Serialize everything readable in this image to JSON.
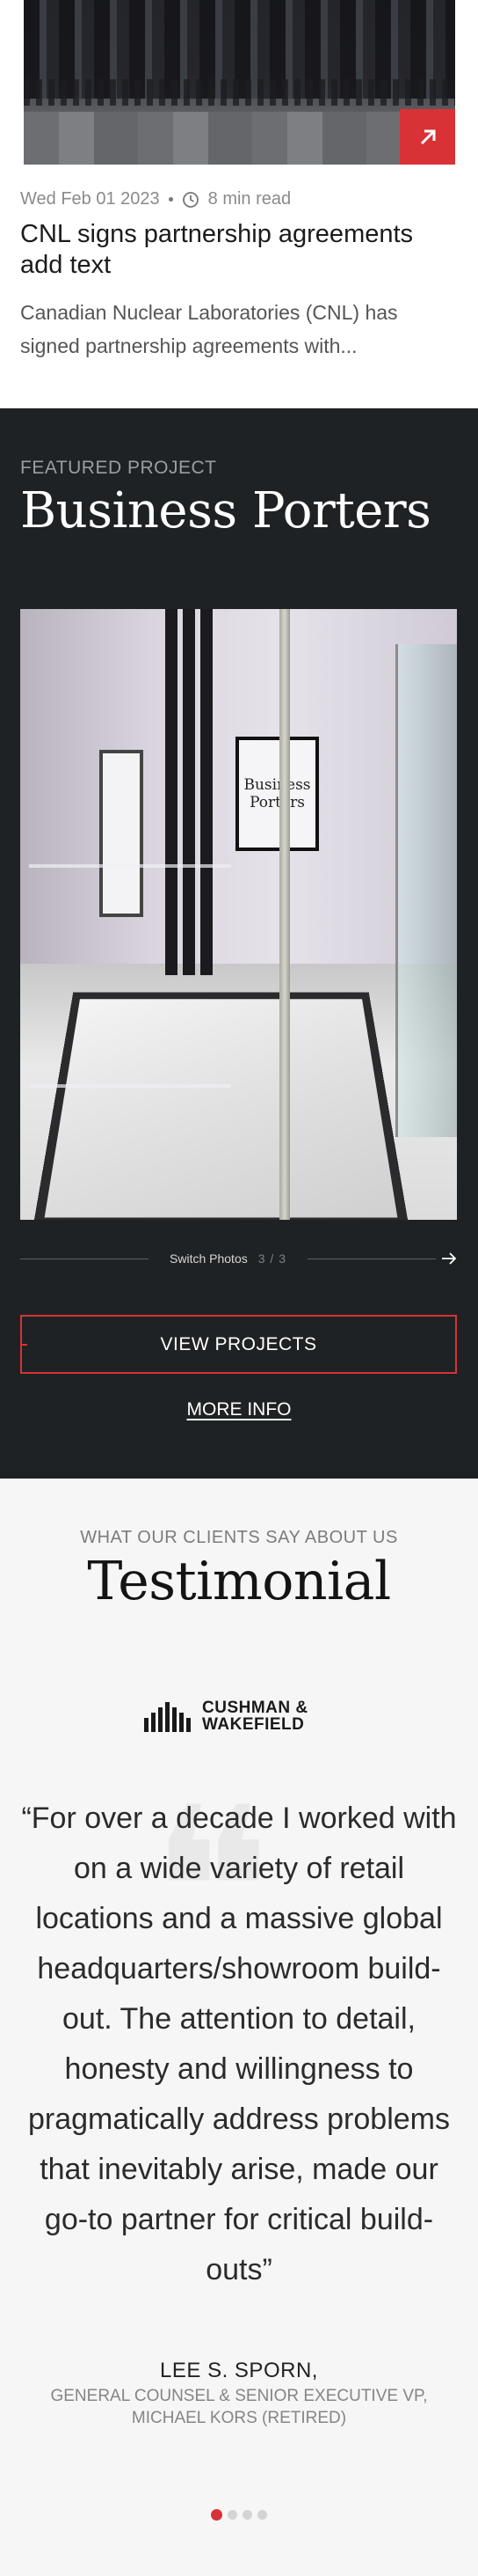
{
  "news": {
    "date": "Wed Feb 01 2023",
    "read_time": "8 min read",
    "title": "CNL signs partnership agreements add text",
    "excerpt": "Canadian Nuclear Laboratories (CNL) has signed partnership agreements with..."
  },
  "featured": {
    "label": "FEATURED PROJECT",
    "title": "Business Porters",
    "photo_sign_text": [
      "Business",
      "Porters"
    ],
    "switch_label": "Switch Photos",
    "switch_count": "3 / 3",
    "view_button": "VIEW PROJECTS",
    "more_info": "MORE INFO"
  },
  "testimonial": {
    "kicker": "WHAT OUR CLIENTS SAY ABOUT US",
    "title": "Testimonial",
    "logo_text": [
      "CUSHMAN &",
      "WAKEFIELD"
    ],
    "quote": "“For over a decade I worked with on a wide variety of retail locations and a massive global headquarters/showroom build-out. The attention to detail, honesty and willingness to pragmatically address problems that inevitably arise, made our go-to partner for critical build-outs”",
    "person": "LEE S. SPORN,",
    "role": "GENERAL COUNSEL & SENIOR EXECUTIVE VP, MICHAEL KORS (RETIRED)",
    "carousel_index": 1,
    "carousel_total": 4
  },
  "colors": {
    "accent": "#d83236",
    "dark_bg": "#1e2224",
    "light_bg": "#f6f6f6"
  },
  "icons": [
    "arrow-up-right-icon",
    "clock-icon",
    "arrow-right-icon",
    "cushman-wakefield-logo",
    "quote-icon"
  ]
}
